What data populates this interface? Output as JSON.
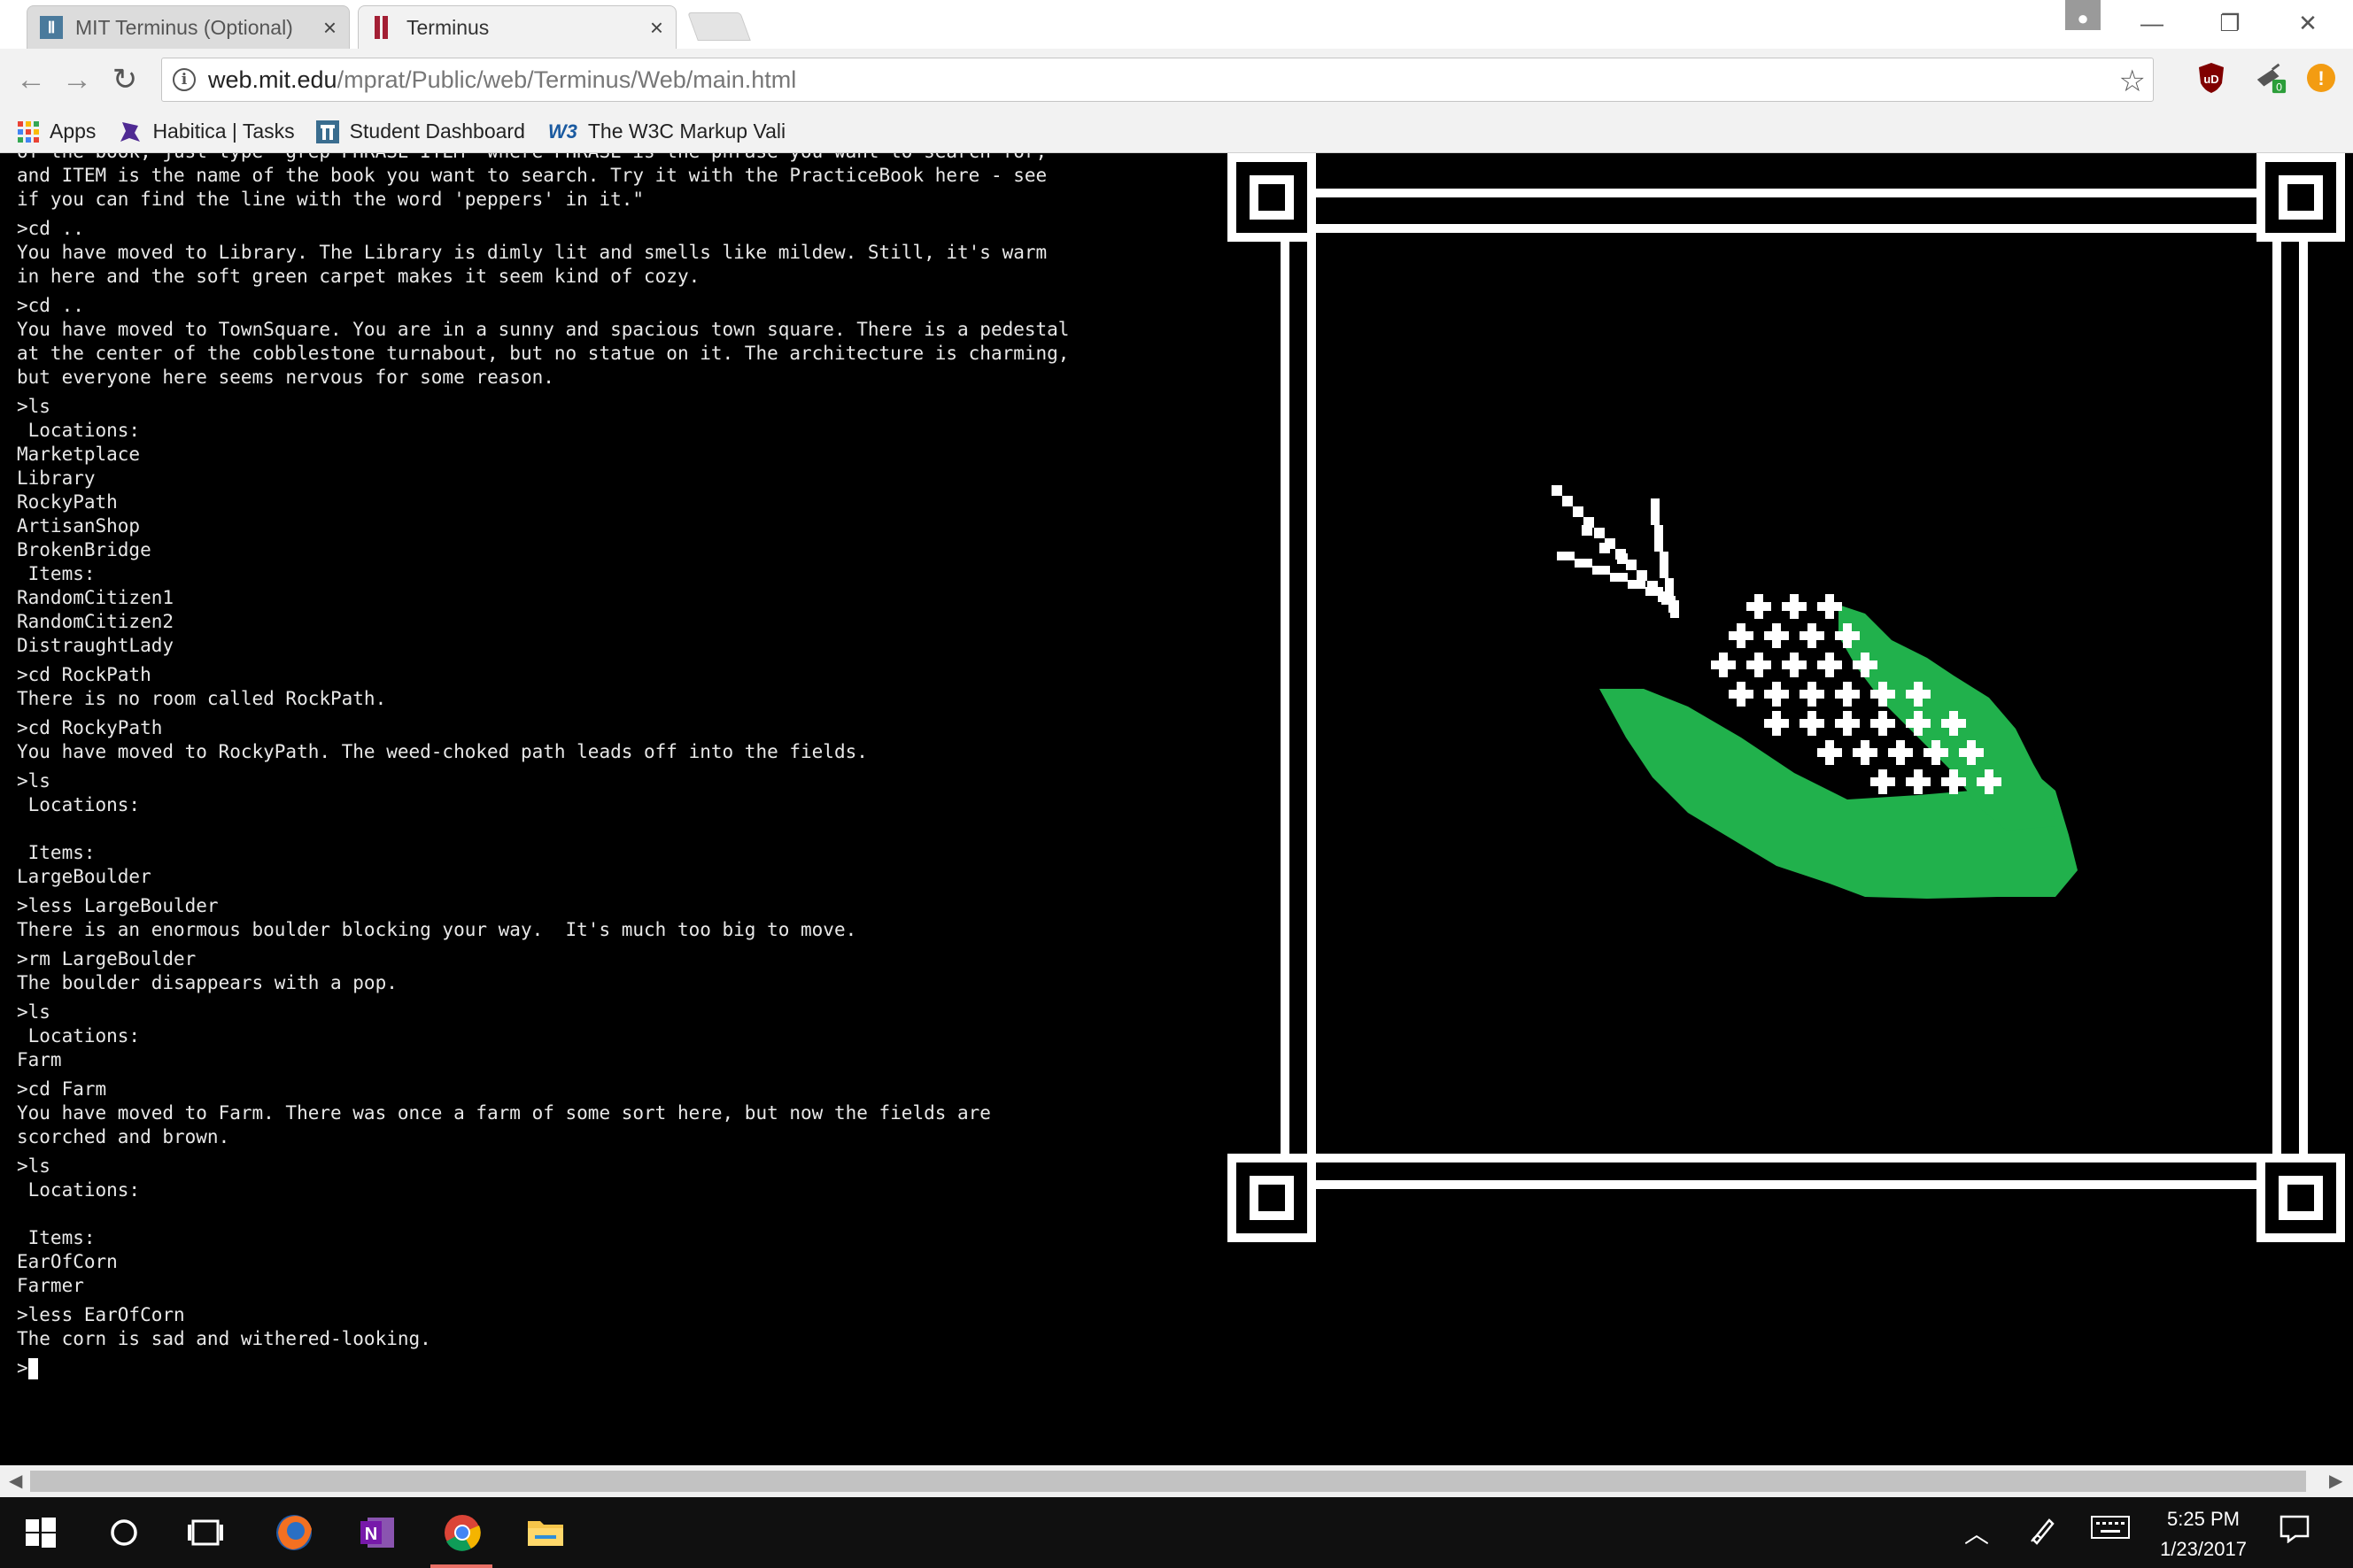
{
  "browser": {
    "tabs": [
      {
        "title": "MIT Terminus (Optional)",
        "active": false,
        "close": "×"
      },
      {
        "title": "Terminus",
        "active": true,
        "close": "×"
      }
    ],
    "window_controls": {
      "minimize": "—",
      "restore": "❐",
      "close": "✕"
    },
    "url": {
      "host": "web.mit.edu",
      "path": "/mprat/Public/web/Terminus/Web/main.html"
    },
    "extensions": {
      "ublock_label": "uD",
      "badge_count": "0",
      "alert_label": "!"
    },
    "bookmarks": [
      {
        "label": "Apps",
        "icon": "apps-grid-icon"
      },
      {
        "label": "Habitica | Tasks",
        "icon": "habitica-icon"
      },
      {
        "label": "Student Dashboard",
        "icon": "mit-icon"
      },
      {
        "label": "The W3C Markup Vali",
        "icon": "w3c-icon"
      }
    ]
  },
  "terminal": {
    "lines": [
      "of the book, just type 'grep PHRASE ITEM' where PHRASE is the phrase you want to search for,",
      "and ITEM is the name of the book you want to search. Try it with the PracticeBook here - see",
      "if you can find the line with the word 'peppers' in it.\"",
      ">cd ..",
      "You have moved to Library. The Library is dimly lit and smells like mildew. Still, it's warm",
      "in here and the soft green carpet makes it seem kind of cozy.",
      ">cd ..",
      "You have moved to TownSquare. You are in a sunny and spacious town square. There is a pedestal",
      "at the center of the cobblestone turnabout, but no statue on it. The architecture is charming,",
      "but everyone here seems nervous for some reason.",
      ">ls",
      " Locations:",
      "Marketplace",
      "Library",
      "RockyPath",
      "ArtisanShop",
      "BrokenBridge",
      " Items:",
      "RandomCitizen1",
      "RandomCitizen2",
      "DistraughtLady",
      ">cd RockPath",
      "There is no room called RockPath.",
      ">cd RockyPath",
      "You have moved to RockyPath. The weed-choked path leads off into the fields.",
      ">ls",
      " Locations:",
      "",
      " Items:",
      "LargeBoulder",
      ">less LargeBoulder",
      "There is an enormous boulder blocking your way.  It's much too big to move.",
      ">rm LargeBoulder",
      "The boulder disappears with a pop.",
      ">ls",
      " Locations:",
      "Farm",
      ">cd Farm",
      "You have moved to Farm. There was once a farm of some sort here, but now the fields are",
      "scorched and brown.",
      ">ls",
      " Locations:",
      "",
      " Items:",
      "EarOfCorn",
      "Farmer",
      ">less EarOfCorn",
      "The corn is sad and withered-looking."
    ],
    "prompt": ">"
  },
  "picture": {
    "subject": "ear-of-corn",
    "colors": {
      "husk": "#21b14c",
      "kernel": "#ffffff",
      "frame": "#ffffff",
      "background": "#000000"
    }
  },
  "taskbar": {
    "apps": [
      "windows-start",
      "cortana-search",
      "task-view",
      "firefox",
      "onenote",
      "chrome",
      "file-explorer"
    ],
    "onenote_label": "N",
    "time": "5:25 PM",
    "date": "1/23/2017"
  }
}
